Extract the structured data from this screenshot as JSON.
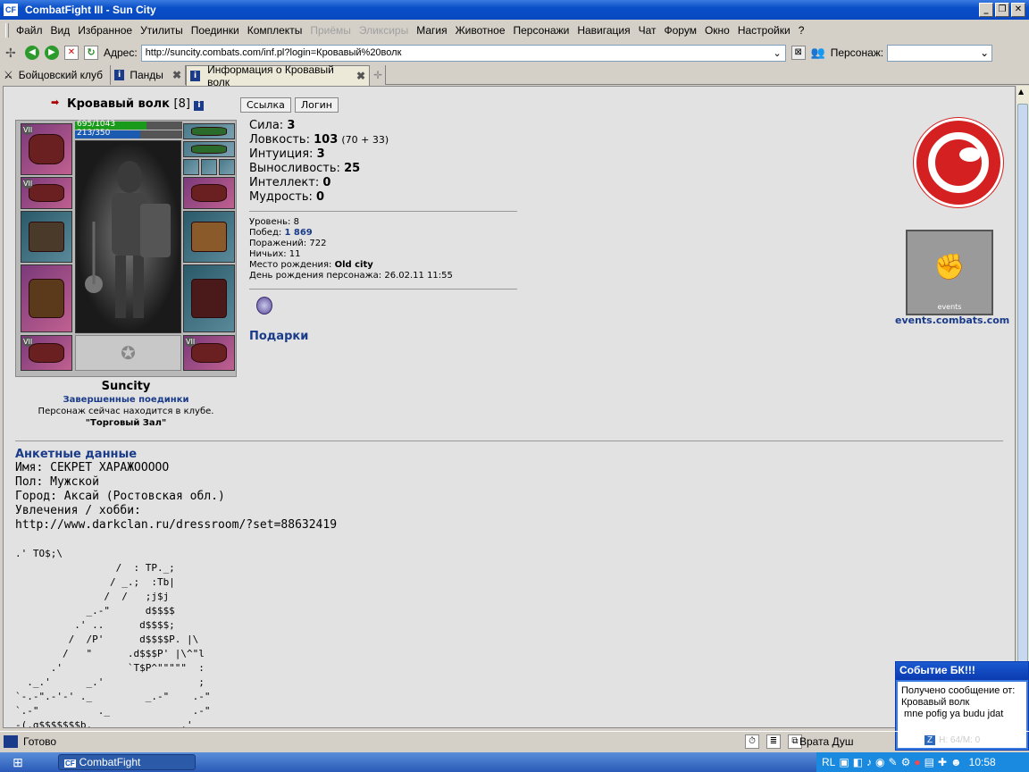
{
  "window": {
    "title": "CombatFight III - Sun City",
    "icon": "CF"
  },
  "menu": [
    "Файл",
    "Вид",
    "Избранное",
    "Утилиты",
    "Поединки",
    "Комплекты",
    "Приёмы",
    "Эликсиры",
    "Магия",
    "Животное",
    "Персонажи",
    "Навигация",
    "Чат",
    "Форум",
    "Окно",
    "Настройки",
    "?"
  ],
  "menu_disabled": [
    "Приёмы",
    "Эликсиры"
  ],
  "address": {
    "label": "Адрес:",
    "url": "http://suncity.combats.com/inf.pl?login=Кровавый%20волк",
    "pers_label": "Персонаж:"
  },
  "tabs": [
    {
      "label": "Бойцовский клуб"
    },
    {
      "label": "Панды"
    },
    {
      "label": "Информация о Кровавый волк"
    }
  ],
  "character": {
    "name": "Кровавый волк",
    "level": "[8]",
    "hp": "695/1043",
    "mana": "213/350",
    "hp_frac": 0.666,
    "mana_frac": 0.609,
    "city": "Suncity",
    "fights_link": "Завершенные поединки",
    "location_text": "Персонаж сейчас находится в клубе.",
    "location": "\"Торговый Зал\"",
    "link_btn": "Ссылка",
    "login_btn": "Логин",
    "stats": [
      {
        "label": "Сила:",
        "value": "3",
        "extra": ""
      },
      {
        "label": "Ловкость:",
        "value": "103",
        "extra": "(70 + 33)"
      },
      {
        "label": "Интуиция:",
        "value": "3",
        "extra": ""
      },
      {
        "label": "Выносливость:",
        "value": "25",
        "extra": ""
      },
      {
        "label": "Интеллект:",
        "value": "0",
        "extra": ""
      },
      {
        "label": "Мудрость:",
        "value": "0",
        "extra": ""
      }
    ],
    "info": {
      "level": "Уровень: 8",
      "wins_label": "Побед:",
      "wins": "1 869",
      "losses": "Поражений: 722",
      "draws": "Ничьих: 11",
      "birthplace_label": "Место рождения:",
      "birthplace": "Old city",
      "birthday": "День рождения персонажа: 26.02.11 11:55"
    },
    "gifts": "Подарки",
    "slot_badge": "VII",
    "events_site": "events.combats.com",
    "events_banner": "events"
  },
  "profile": {
    "heading": "Анкетные данные",
    "name": "Имя: СЕКРЕТ ХАРАЖООООО",
    "sex": "Пол: Мужской",
    "city": "Город: Аксай (Ростовская обл.)",
    "hobby": "Увлечения / хобби:",
    "link": "http://www.darkclan.ru/dressroom/?set=88632419",
    "ascii": [
      ".' TO$;\\",
      "                 /  : TP._;",
      "                / _.;  :Tb|",
      "               /  /   ;j$j",
      "            _.-\"      d$$$$",
      "          .' ..      d$$$$;",
      "         /  /P'      d$$$$P. |\\",
      "        /   \"      .d$$$P' |\\^\"l",
      "      .'           `T$P^\"\"\"\"\"  :",
      "  ._.'      _.'                ;",
      "`-.-\".-'-' ._         _.-\"    .-\"",
      "`.-\"          ._              .-\"",
      "-(.g$$$$$$$b.               .'"
    ]
  },
  "popup": {
    "title": "Событие БК!!!",
    "line1": "Получено сообщение от:",
    "line2": "Кровавый волк",
    "line3": " mne pofig ya budu jdat",
    "footer": "H: 64/M: 0",
    "badge": "Z"
  },
  "status": {
    "text": "Готово",
    "location": "Врата Душ"
  },
  "taskbar": {
    "app": "CombatFight",
    "lang": "RL",
    "time": "10:58"
  }
}
